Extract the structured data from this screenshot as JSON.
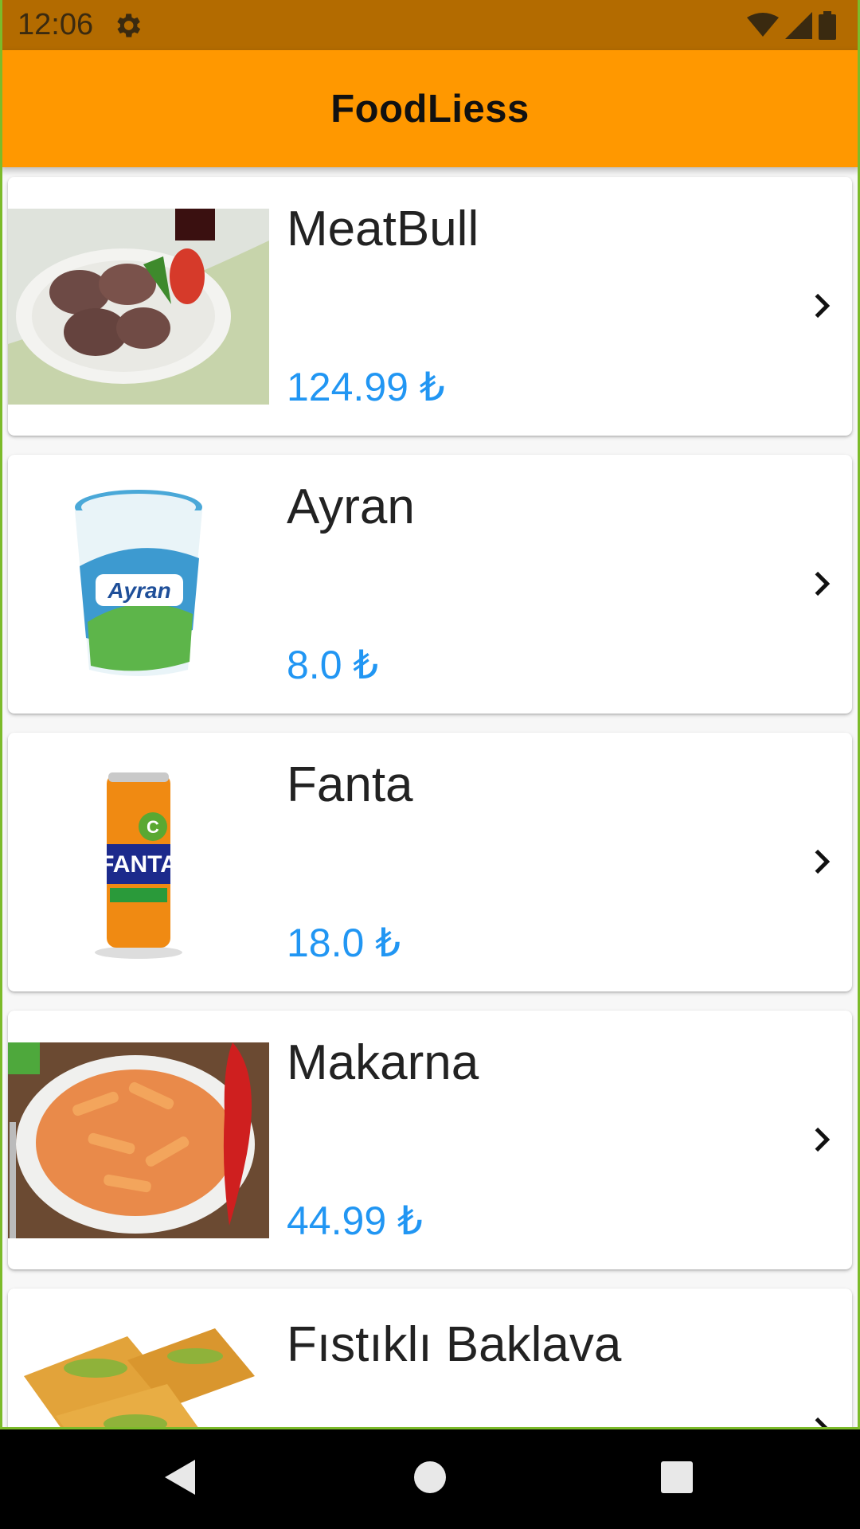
{
  "status_bar": {
    "time": "12:06",
    "icons": [
      "gear-icon",
      "wifi-icon",
      "signal-icon",
      "battery-icon"
    ]
  },
  "app_bar": {
    "title": "FoodLiess",
    "color": "#ff9800"
  },
  "products": [
    {
      "name": "MeatBull",
      "price": "124.99 ₺",
      "image": "meatball-plate-image"
    },
    {
      "name": "Ayran",
      "price": "8.0 ₺",
      "image": "ayran-cup-image"
    },
    {
      "name": "Fanta",
      "price": "18.0 ₺",
      "image": "fanta-can-image"
    },
    {
      "name": "Makarna",
      "price": "44.99 ₺",
      "image": "penne-pasta-image"
    },
    {
      "name": "Fıstıklı Baklava",
      "price": "",
      "image": "baklava-image"
    }
  ],
  "colors": {
    "status_bar": "#b36b00",
    "price": "#2196f3",
    "background": "#f7f7f7"
  },
  "nav_bar": {
    "buttons": [
      "back-icon",
      "home-icon",
      "recents-icon"
    ]
  }
}
